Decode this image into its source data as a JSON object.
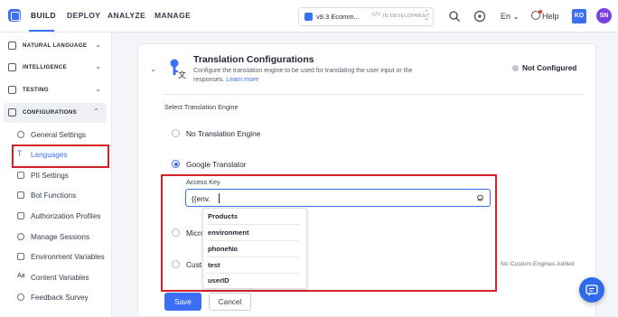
{
  "topbar": {
    "nav": [
      "BUILD",
      "DEPLOY",
      "ANALYZE",
      "MANAGE"
    ],
    "app_name": "v9.3 Ecomm...",
    "app_separator": "</>",
    "app_status": "IN DEVELOPMENT",
    "language": "En",
    "language_chevron": "⌄",
    "help": "Help",
    "user_initials": "KO",
    "profile_initials": "SN"
  },
  "sidebar": {
    "sections": [
      {
        "label": "NATURAL LANGUAGE",
        "icon": "natural-language-icon"
      },
      {
        "label": "INTELLIGENCE",
        "icon": "intelligence-icon"
      },
      {
        "label": "TESTING",
        "icon": "testing-icon"
      },
      {
        "label": "CONFIGURATIONS",
        "icon": "configurations-icon"
      }
    ],
    "items": [
      {
        "label": "General Settings",
        "icon": "settings-icon"
      },
      {
        "label": "Languages",
        "icon": "text-icon"
      },
      {
        "label": "PII Settings",
        "icon": "shield-icon"
      },
      {
        "label": "Bot Functions",
        "icon": "function-icon"
      },
      {
        "label": "Authorization Profiles",
        "icon": "lock-icon"
      },
      {
        "label": "Manage Sessions",
        "icon": "clock-icon"
      },
      {
        "label": "Environment Variables",
        "icon": "variables-icon"
      },
      {
        "label": "Content Variables",
        "icon": "content-icon"
      },
      {
        "label": "Feedback Survey",
        "icon": "feedback-icon"
      }
    ]
  },
  "main": {
    "title": "Translation Configurations",
    "description": "Configure the translation engine to be used for translating the user input or the responses.",
    "learn_more": "Learn more",
    "status": "Not Configured",
    "engine_label": "Select Translation Engine",
    "options": {
      "none": "No Translation Engine",
      "google": "Google Translator",
      "microsoft": "Micro",
      "custom": "Cust"
    },
    "access_key_label": "Access Key",
    "access_key_value": "{{env.",
    "dropdown": [
      "Products",
      "environment",
      "phoneNo",
      "test",
      "userID"
    ],
    "no_custom": "No Custom Engines Added",
    "save": "Save",
    "cancel": "Cancel"
  },
  "colors": {
    "accent": "#3b6ff5",
    "highlight": "#d92027"
  }
}
